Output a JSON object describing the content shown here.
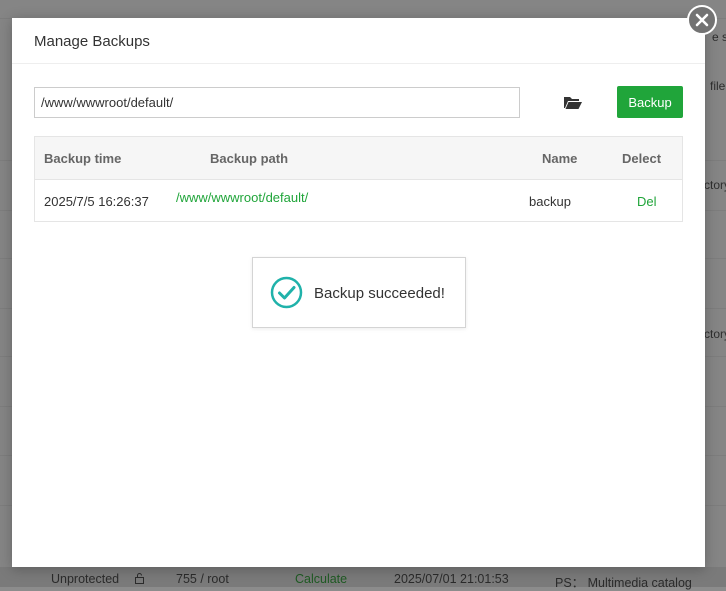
{
  "background": {
    "right_fragments": [
      "e se",
      "file",
      "ctory",
      "ctory"
    ],
    "bottom_row": {
      "protection": "Unprotected",
      "permission": "755 / root",
      "size_action": "Calculate",
      "modified": "2025/07/01 21:01:53",
      "note": "PS： Multimedia catalog"
    }
  },
  "dialog": {
    "title": "Manage Backups",
    "path_value": "/www/wwwroot/default/",
    "backup_button": "Backup",
    "columns": [
      "Backup time",
      "Backup path",
      "Name",
      "Delect"
    ],
    "rows": [
      {
        "time": "2025/7/5 16:26:37",
        "path": "/www/wwwroot/default/",
        "name": "backup",
        "action": "Del"
      }
    ]
  },
  "toast": {
    "message": "Backup succeeded!"
  },
  "icons": {
    "close": "close-icon",
    "folder": "folder-open-icon",
    "success": "check-circle-icon"
  },
  "colors": {
    "accent": "#20a53a",
    "overlay": "rgba(0,0,0,0.45)"
  }
}
